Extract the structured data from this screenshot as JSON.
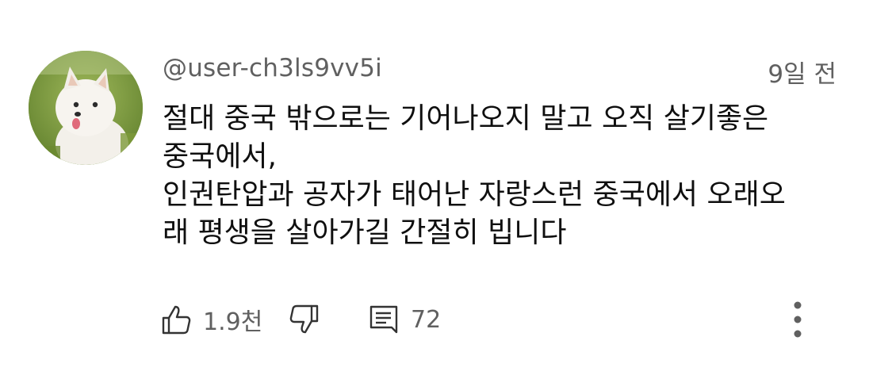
{
  "comment": {
    "author": "@user-ch3ls9vv5i",
    "timestamp": "9일 전",
    "text_lines": [
      "절대 중국 밖으로는 기어나오지 말고 오직 살기좋은",
      "중국에서,",
      "인권탄압과 공자가 태어난 자랑스런 중국에서 오래오",
      "래 평생을 살아가길 간절히 빕니다"
    ],
    "likes": "1.9천",
    "replies": "72"
  },
  "icons": {
    "like": "thumbs-up-icon",
    "dislike": "thumbs-down-icon",
    "reply": "comment-icon",
    "more": "more-vertical-icon"
  },
  "colors": {
    "text_primary": "#0f0f0f",
    "text_secondary": "#606060",
    "background": "#ffffff"
  }
}
